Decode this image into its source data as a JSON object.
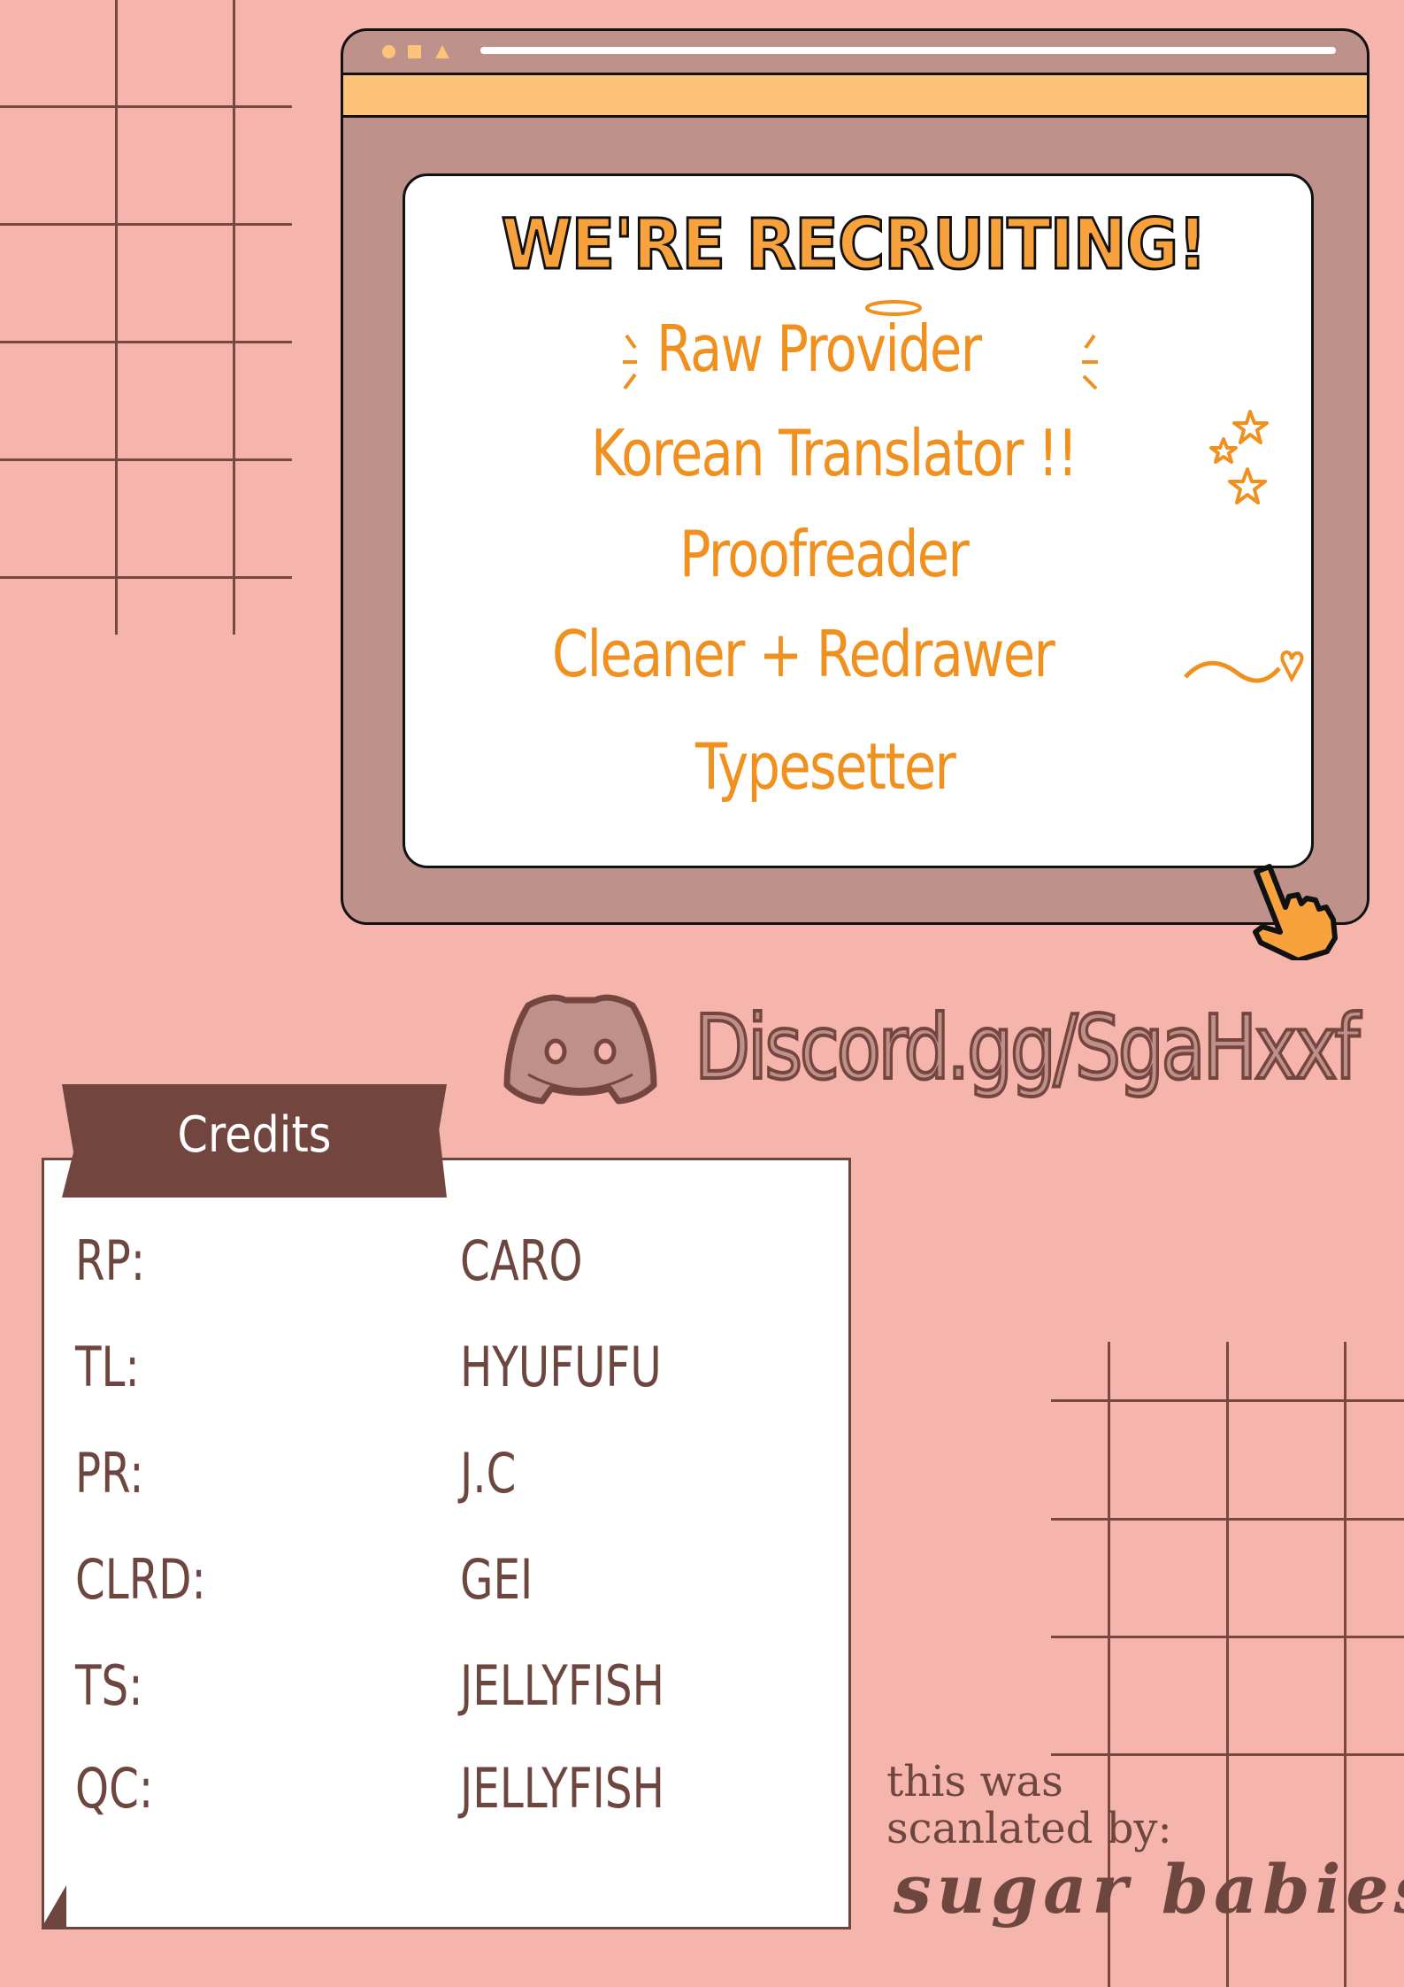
{
  "colors": {
    "background": "#f5b4ac",
    "window_frame": "#be918b",
    "accent_orange": "#f0901e",
    "title_orange": "#f7a23c",
    "bar_orange": "#fdc37b",
    "brown": "#6e4640"
  },
  "window": {
    "titlebar_icons": [
      "circle-icon",
      "square-icon",
      "triangle-icon"
    ],
    "pointer_icon": "pointing-hand-icon"
  },
  "recruiting": {
    "title": "WE'RE RECRUITING!",
    "roles": [
      {
        "label": "Raw Provider"
      },
      {
        "label": "Korean Translator !!"
      },
      {
        "label": "Proofreader"
      },
      {
        "label": "Cleaner + Redrawer"
      },
      {
        "label": "Typesetter"
      }
    ]
  },
  "discord": {
    "icon": "discord-icon",
    "link_text": "Discord.gg/SgaHxxf"
  },
  "credits": {
    "title": "Credits",
    "rows": [
      {
        "role": "RP:",
        "name": "CARO"
      },
      {
        "role": "TL:",
        "name": "HYUFUFU"
      },
      {
        "role": "PR:",
        "name": "J.C"
      },
      {
        "role": "CLRD:",
        "name": "GEI"
      },
      {
        "role": "TS:",
        "name": "JELLYFISH"
      },
      {
        "role": "QC:",
        "name": "JELLYFISH"
      }
    ]
  },
  "signature": {
    "line1": "this was",
    "line2": "scanlated by:",
    "group": "sugar babies"
  }
}
